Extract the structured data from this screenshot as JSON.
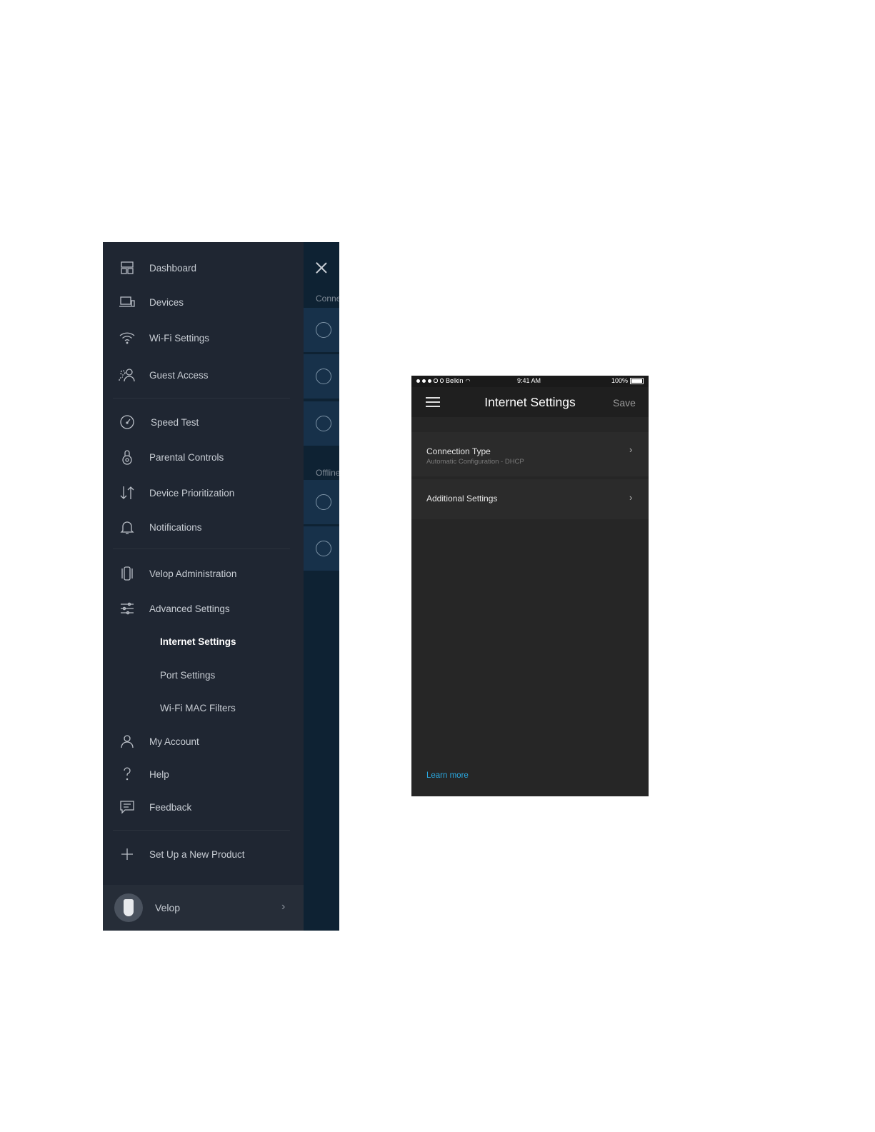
{
  "drawer": {
    "items": [
      {
        "label": "Dashboard",
        "icon": "dashboard-icon"
      },
      {
        "label": "Devices",
        "icon": "devices-icon"
      },
      {
        "label": "Wi-Fi Settings",
        "icon": "wifi-icon"
      },
      {
        "label": "Guest Access",
        "icon": "guest-icon"
      },
      {
        "label": "Speed Test",
        "icon": "speedometer-icon"
      },
      {
        "label": "Parental Controls",
        "icon": "parental-lock-icon"
      },
      {
        "label": "Device Prioritization",
        "icon": "priority-arrows-icon"
      },
      {
        "label": "Notifications",
        "icon": "bell-icon"
      },
      {
        "label": "Velop Administration",
        "icon": "velop-node-icon"
      },
      {
        "label": "Advanced Settings",
        "icon": "sliders-icon"
      },
      {
        "label": "My Account",
        "icon": "user-icon"
      },
      {
        "label": "Help",
        "icon": "question-icon"
      },
      {
        "label": "Feedback",
        "icon": "feedback-icon"
      },
      {
        "label": "Set Up a New Product",
        "icon": "plus-icon"
      }
    ],
    "sub_items": [
      {
        "label": "Internet Settings",
        "active": true
      },
      {
        "label": "Port Settings",
        "active": false
      },
      {
        "label": "Wi-Fi MAC Filters",
        "active": false
      }
    ],
    "product": {
      "label": "Velop"
    },
    "peek": {
      "connected_heading": "Conne",
      "offline_heading": "Offline"
    }
  },
  "phone": {
    "status": {
      "carrier": "Belkin",
      "time": "9:41 AM",
      "battery": "100%"
    },
    "title": "Internet Settings",
    "save_label": "Save",
    "rows": [
      {
        "title": "Connection Type",
        "subtitle": "Automatic Configuration - DHCP"
      },
      {
        "title": "Additional Settings"
      }
    ],
    "learn_more": "Learn more"
  },
  "colors": {
    "drawer_bg": "#1f2632",
    "underlay_bg": "#0e2233",
    "phone_bg": "#262626",
    "link": "#2aa8e0"
  }
}
